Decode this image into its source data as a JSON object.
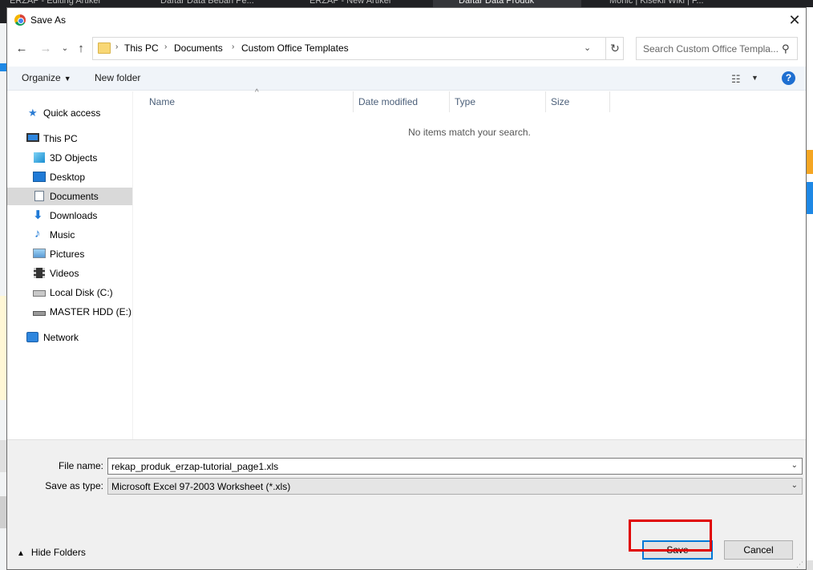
{
  "background": {
    "tabs": [
      "ERZAP - Editing Artikel",
      "Daftar Data Beban Pe...",
      "ERZAP - New Artikel",
      "Daftar Data Produk",
      "Monic | Kisekii Wiki | F..."
    ]
  },
  "dialog": {
    "title": "Save As",
    "close_glyph": "✕",
    "address": {
      "crumbs": [
        "This PC",
        "Documents",
        "Custom Office Templates"
      ],
      "separator": "›"
    },
    "search": {
      "placeholder": "Search Custom Office Templa..."
    },
    "toolbar": {
      "organize_label": "Organize",
      "new_folder_label": "New folder",
      "help_glyph": "?"
    },
    "nav_pane": {
      "items": [
        {
          "label": "Quick access",
          "icon": "star-icon"
        },
        {
          "label": "This PC",
          "icon": "computer-icon"
        },
        {
          "label": "3D Objects",
          "icon": "cube-icon"
        },
        {
          "label": "Desktop",
          "icon": "desktop-icon"
        },
        {
          "label": "Documents",
          "icon": "document-icon",
          "selected": true
        },
        {
          "label": "Downloads",
          "icon": "download-arrow-icon"
        },
        {
          "label": "Music",
          "icon": "music-note-icon"
        },
        {
          "label": "Pictures",
          "icon": "picture-icon"
        },
        {
          "label": "Videos",
          "icon": "film-icon"
        },
        {
          "label": "Local Disk (C:)",
          "icon": "windows-drive-icon"
        },
        {
          "label": "MASTER HDD (E:)",
          "icon": "drive-icon"
        },
        {
          "label": "Network",
          "icon": "network-icon"
        }
      ]
    },
    "file_list": {
      "columns": [
        "Name",
        "Date modified",
        "Type",
        "Size"
      ],
      "empty_message": "No items match your search."
    },
    "file_name": {
      "label": "File name:",
      "value": "rekap_produk_erzap-tutorial_page1.xls"
    },
    "save_as_type": {
      "label": "Save as type:",
      "value": "Microsoft Excel 97-2003 Worksheet (*.xls)"
    },
    "hide_folders_label": "Hide Folders",
    "save_label": "Save",
    "cancel_label": "Cancel"
  },
  "colors": {
    "accent": "#0078d7",
    "highlight": "#e00000",
    "toolbar_bg": "#f0f4f9",
    "selected_bg": "#d9d9d9"
  }
}
